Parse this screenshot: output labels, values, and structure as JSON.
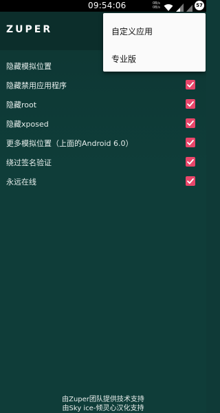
{
  "status_bar": {
    "time": "09:54:06",
    "speed_line1": "0B/s",
    "speed_line2": "0B/s",
    "battery": "57",
    "wifi_icon": "wifi-icon",
    "signal_icon": "signal-icon"
  },
  "app_bar": {
    "title": "ZUPER"
  },
  "menu": {
    "items": [
      {
        "label": "自定义应用"
      },
      {
        "label": "专业版"
      }
    ]
  },
  "options": [
    {
      "label": "隐藏模拟位置",
      "checked": true
    },
    {
      "label": "隐藏禁用应用程序",
      "checked": true
    },
    {
      "label": "隐藏root",
      "checked": true
    },
    {
      "label": "隐藏xposed",
      "checked": true
    },
    {
      "label": "更多模拟位置（上面的Android 6.0）",
      "checked": true
    },
    {
      "label": "绕过签名验证",
      "checked": true
    },
    {
      "label": "永远在线",
      "checked": true
    }
  ],
  "footer": {
    "line1": "由Zuper团队提供技术支持",
    "line2": "由Sky ice-倾灵心汉化支持"
  },
  "colors": {
    "background": "#0f3d39",
    "app_bar": "#0c2e2b",
    "checkbox": "#e8466a"
  }
}
